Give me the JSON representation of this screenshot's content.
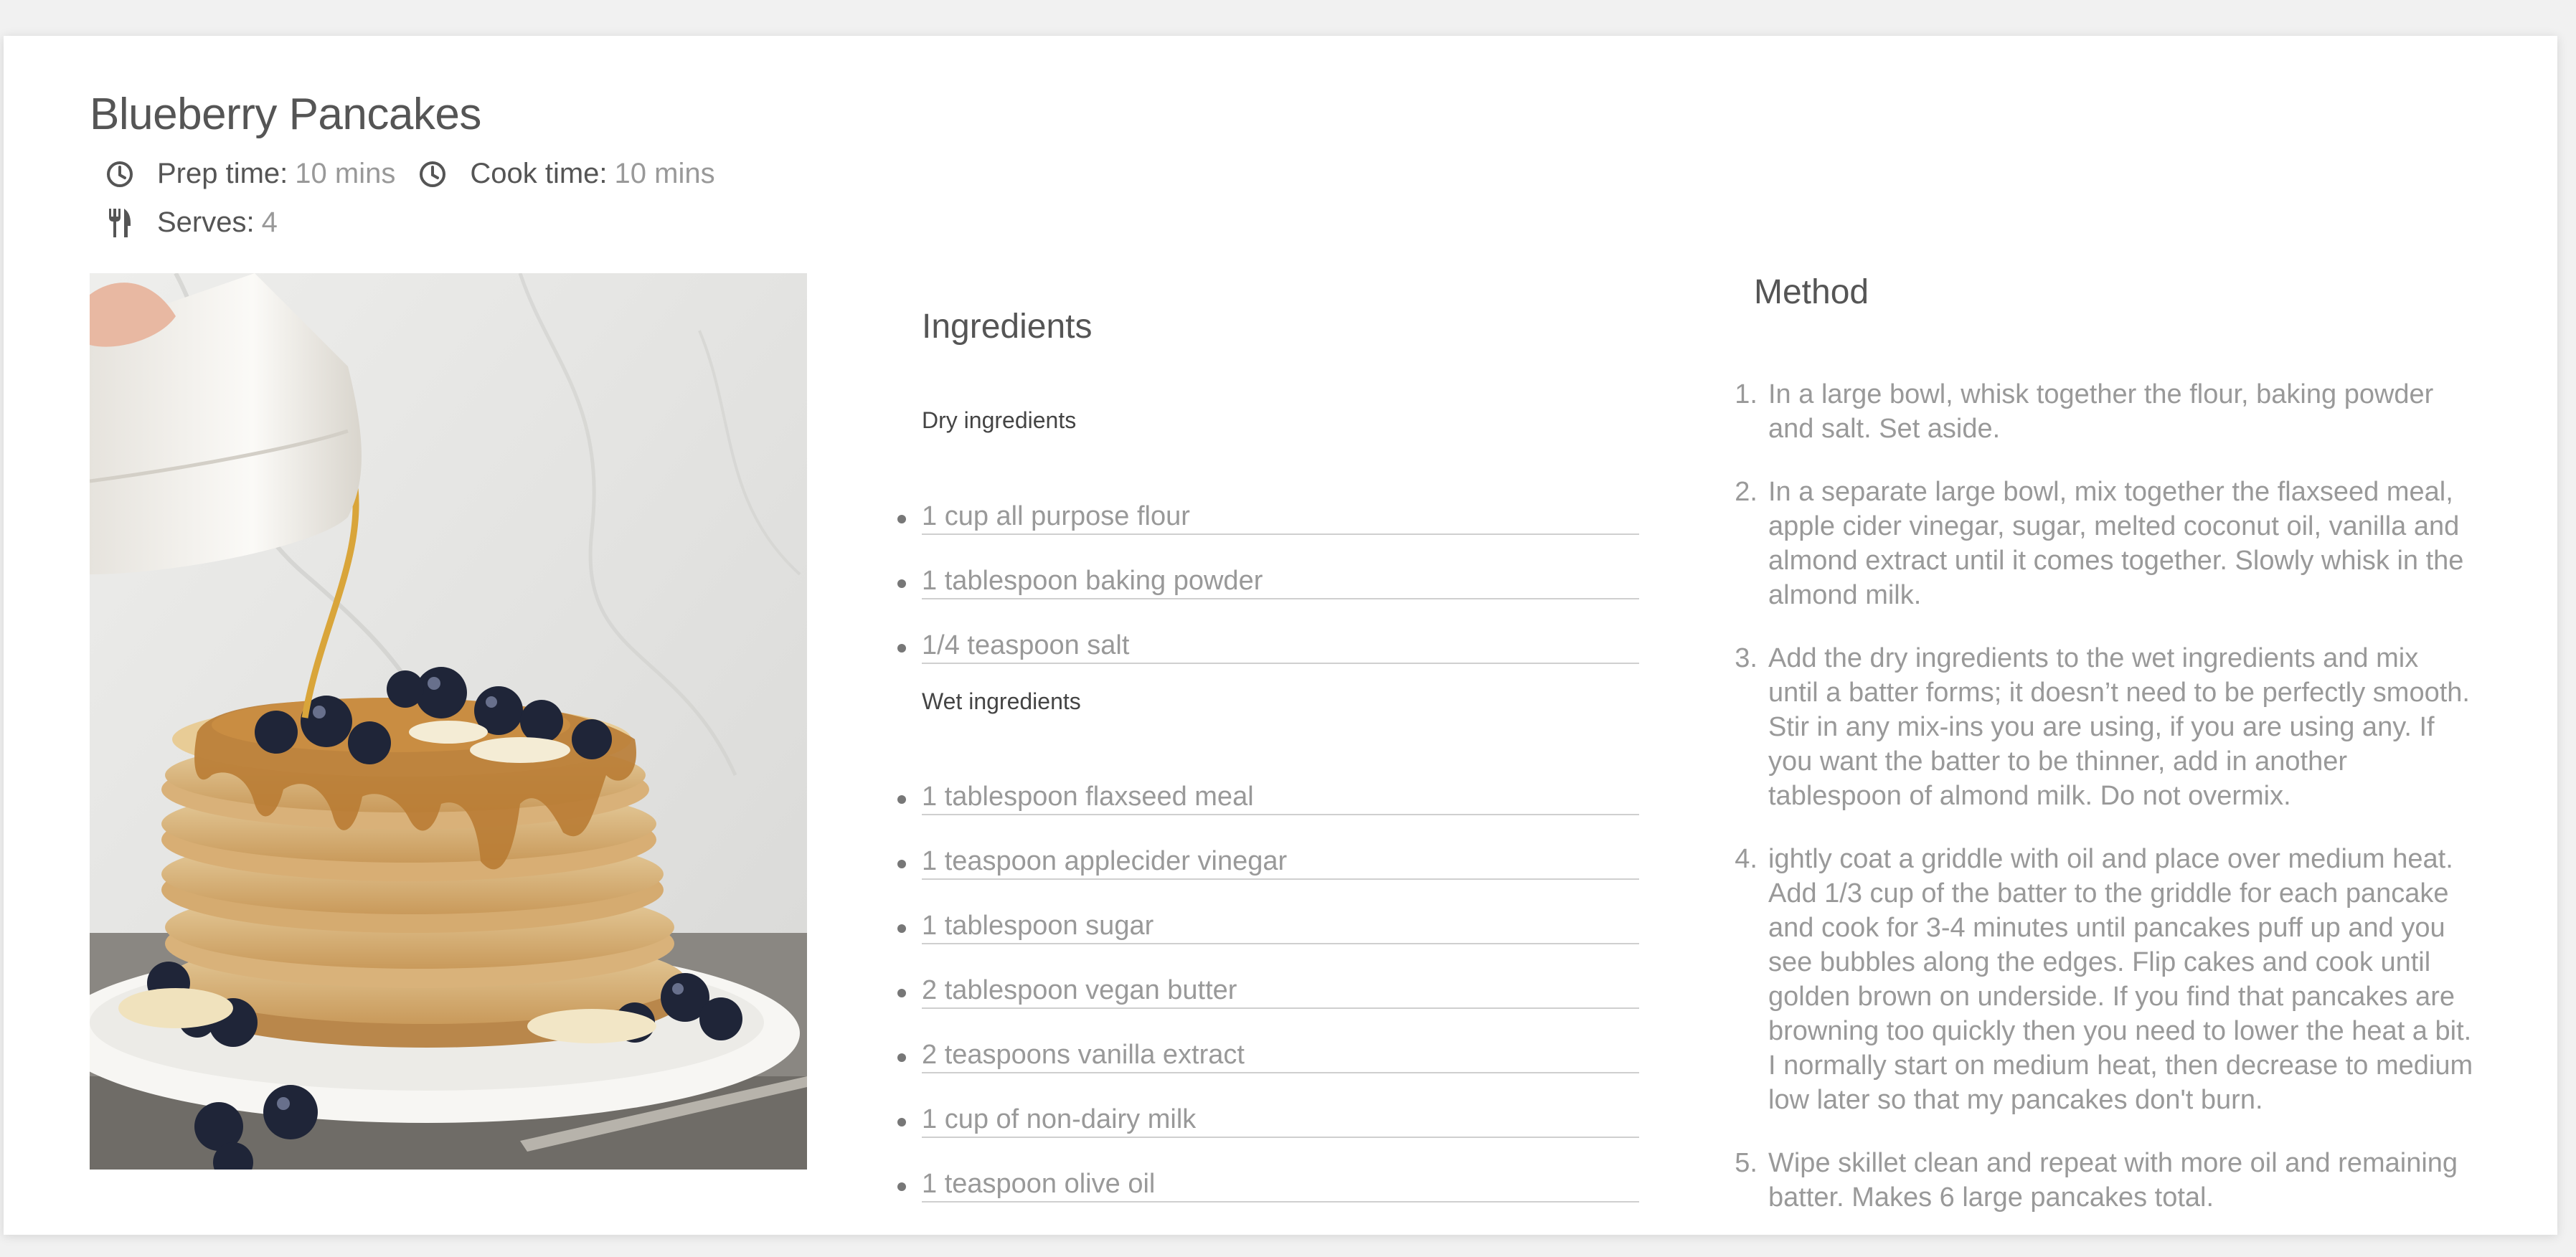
{
  "recipe": {
    "title": "Blueberry Pancakes",
    "prep_label": "Prep time:",
    "prep_value": "10 mins",
    "cook_label": "Cook time:",
    "cook_value": "10 mins",
    "serves_label": "Serves:",
    "serves_value": "4",
    "icons": {
      "time": "clock-icon",
      "serves": "fork-knife-icon",
      "photo": "pancake-stack-photo"
    }
  },
  "ingredients": {
    "heading": "Ingredients",
    "dry_heading": "Dry ingredients",
    "dry": [
      "1 cup all purpose flour",
      "1 tablespoon baking powder",
      "1/4 teaspoon salt"
    ],
    "wet_heading": "Wet ingredients",
    "wet": [
      "1 tablespoon flaxseed meal",
      "1 teaspoon applecider vinegar",
      "1 tablespoon sugar",
      "2 tablespoon vegan butter",
      "2 teaspoons vanilla extract",
      "1 cup of non-dairy milk",
      "1 teaspoon olive oil"
    ]
  },
  "method": {
    "heading": "Method",
    "steps": [
      {
        "num": "1.",
        "text": "In a large bowl, whisk together the flour, baking powder and salt. Set aside."
      },
      {
        "num": "2.",
        "text": "In a separate large bowl, mix together the flaxseed meal, apple cider vinegar, sugar, melted coconut oil, vanilla and almond extract until it comes together. Slowly whisk in the almond milk."
      },
      {
        "num": "3.",
        "text": "Add the dry ingredients to the wet ingredients and mix until a batter forms; it doesn’t need to be perfectly smooth. Stir in any mix-ins you are using, if you are using any. If you want the batter to be thinner, add in another tablespoon of almond milk. Do not overmix."
      },
      {
        "num": "4.",
        "text": "ightly coat a griddle with oil and place over medium heat. Add 1/3 cup of the batter to the griddle for each pancake and cook for 3-4 minutes until pancakes puff up and you see bubbles along the edges. Flip cakes and cook until golden brown on underside. If you find that pancakes are browning too quickly then you need to lower the heat a bit. I normally start on medium heat, then decrease to medium low later so that my pancakes don't burn."
      },
      {
        "num": "5.",
        "text": "Wipe skillet clean and repeat with more oil and remaining batter. Makes 6 large pancakes total."
      }
    ]
  },
  "colors": {
    "text": "#555555",
    "muted": "#999999",
    "rule": "#cfcfcf",
    "background": "#f1f1f1"
  }
}
